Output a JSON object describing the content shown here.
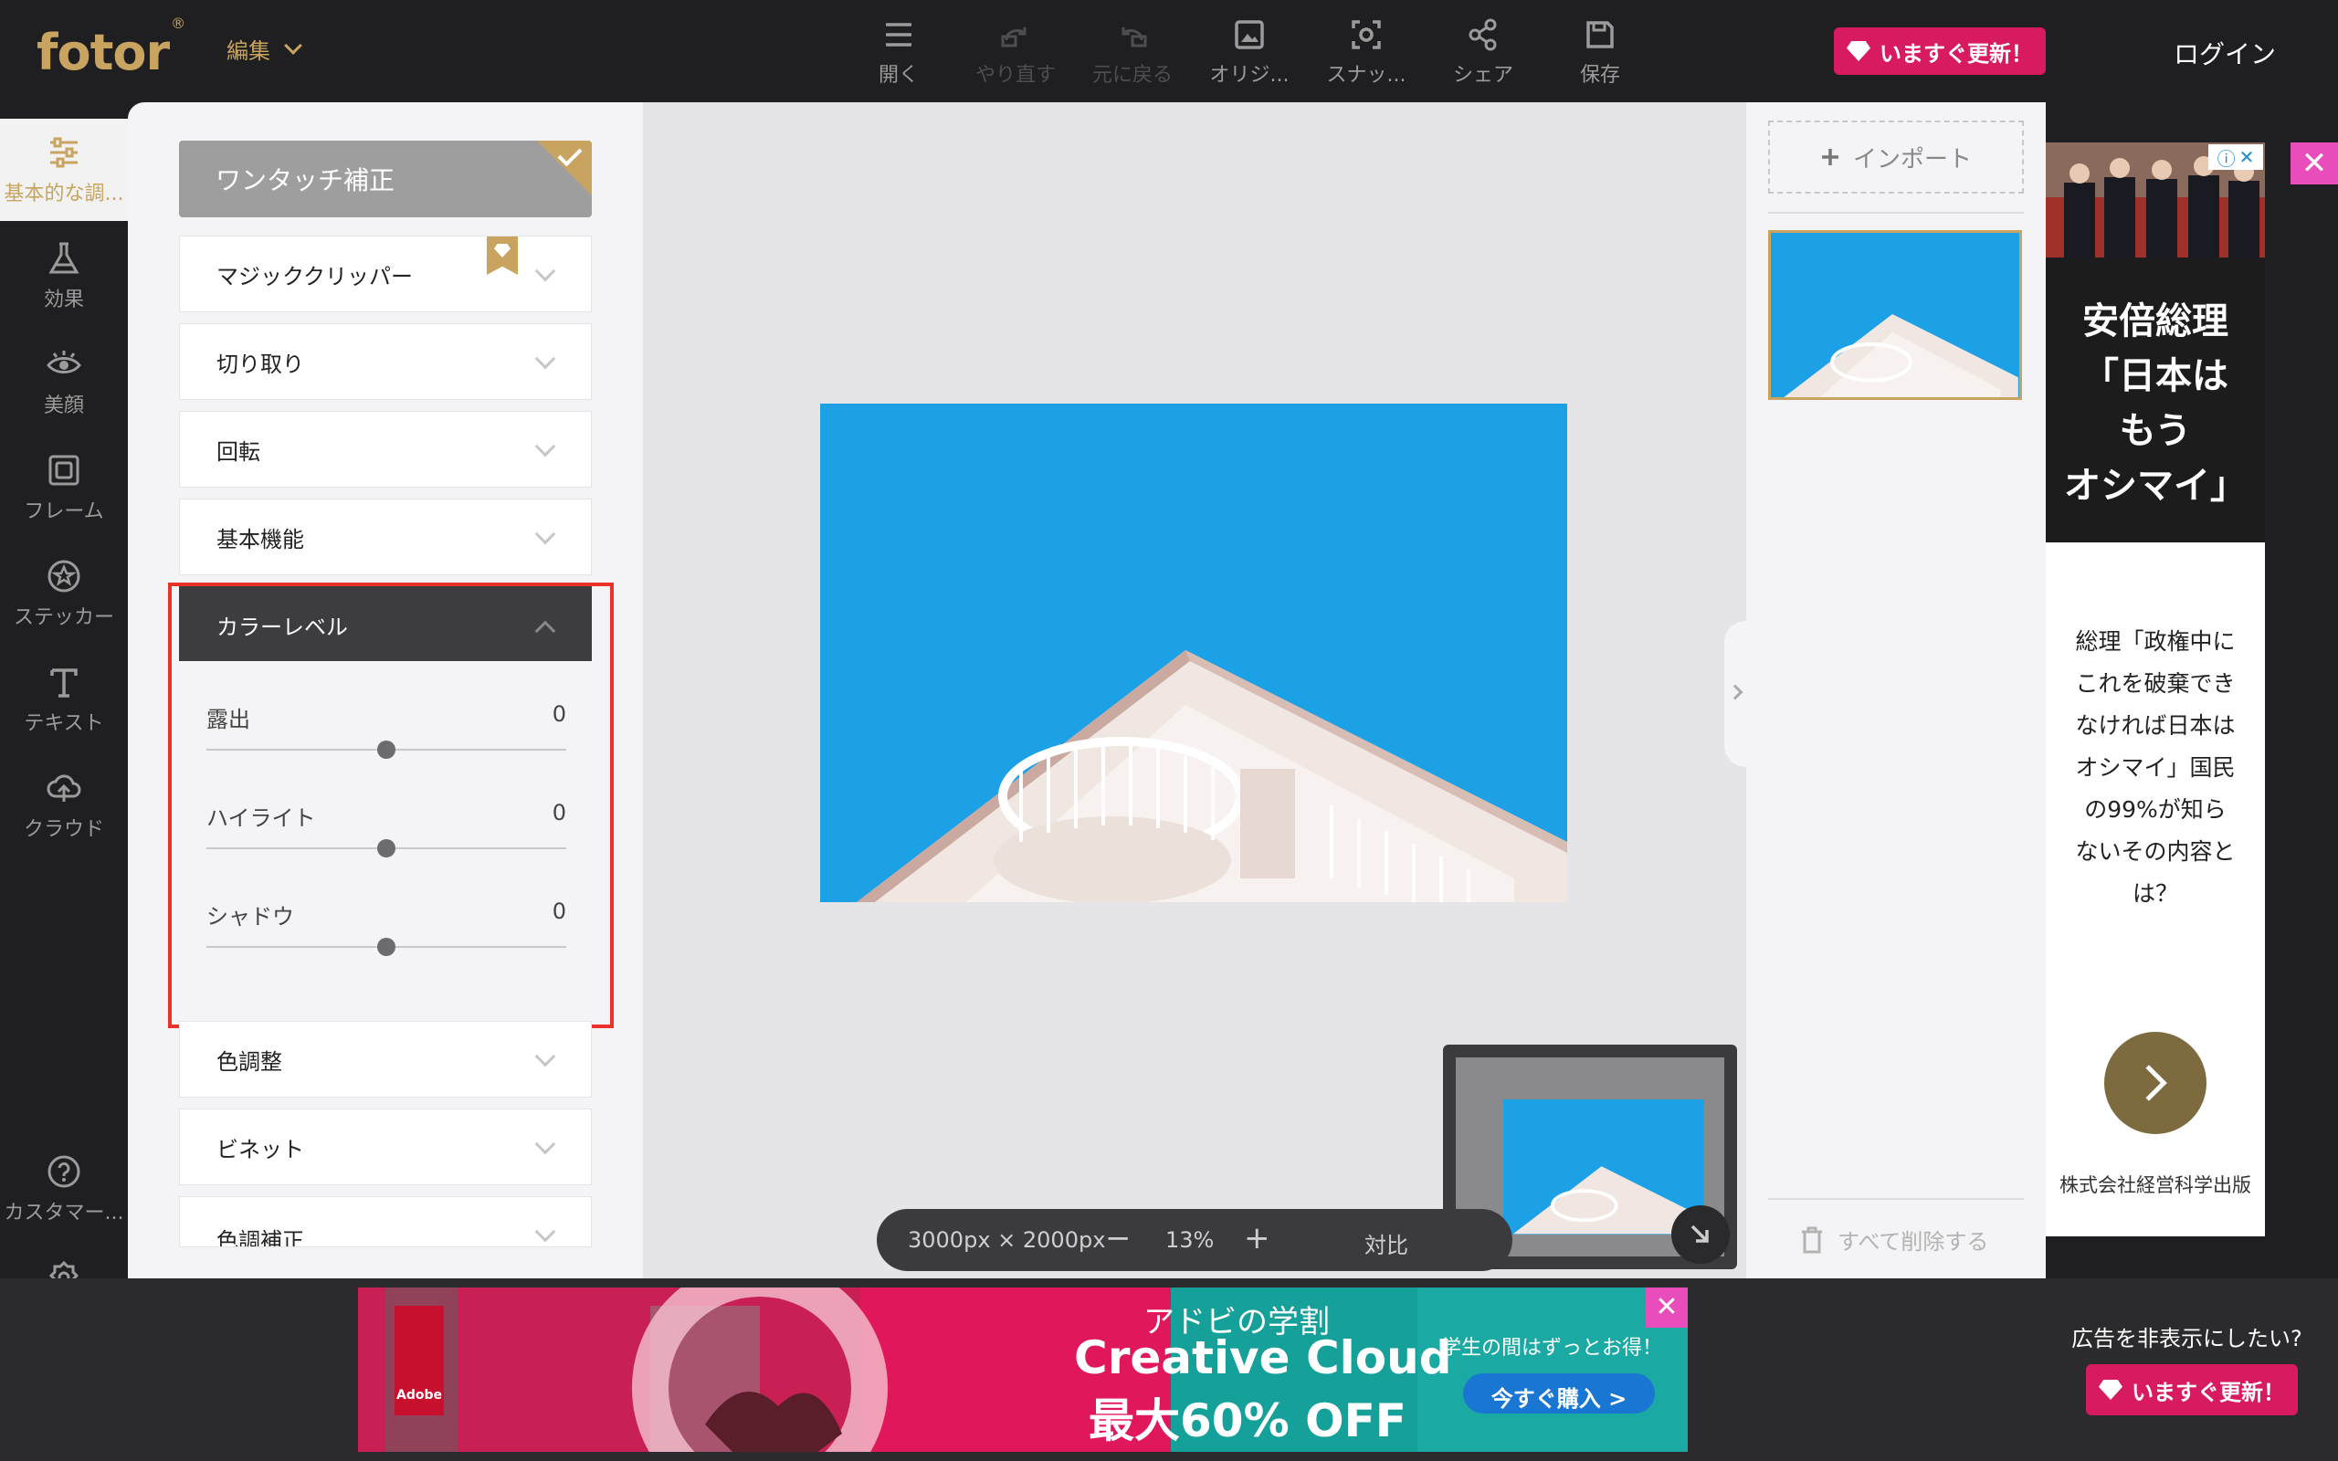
{
  "app": {
    "logo": "fotor",
    "logo_mark": "®",
    "edit_menu": "編集",
    "login": "ログイン",
    "upgrade": "いますぐ更新！"
  },
  "toolbar": [
    {
      "label": "開く",
      "icon": "menu-icon",
      "enabled": true
    },
    {
      "label": "やり直す",
      "icon": "redo-icon",
      "enabled": false
    },
    {
      "label": "元に戻る",
      "icon": "undo-icon",
      "enabled": false
    },
    {
      "label": "オリジ...",
      "icon": "image-icon",
      "enabled": true
    },
    {
      "label": "スナッ...",
      "icon": "snapshot-icon",
      "enabled": true
    },
    {
      "label": "シェア",
      "icon": "share-icon",
      "enabled": true
    },
    {
      "label": "保存",
      "icon": "save-icon",
      "enabled": true
    }
  ],
  "rail": [
    {
      "label": "基本的な調...",
      "icon": "sliders-icon",
      "active": true
    },
    {
      "label": "効果",
      "icon": "flask-icon"
    },
    {
      "label": "美顔",
      "icon": "eye-icon"
    },
    {
      "label": "フレーム",
      "icon": "frame-icon"
    },
    {
      "label": "ステッカー",
      "icon": "star-icon"
    },
    {
      "label": "テキスト",
      "icon": "text-icon"
    },
    {
      "label": "クラウド",
      "icon": "cloud-icon"
    },
    {
      "label": "カスタマー...",
      "icon": "help-icon"
    },
    {
      "label": "設定",
      "icon": "gear-icon"
    }
  ],
  "panel": {
    "one_touch": "ワンタッチ補正",
    "sections": {
      "magic": "マジッククリッパー",
      "crop": "切り取り",
      "rotate": "回転",
      "basic": "基本機能",
      "color_level": "カラーレベル",
      "color_adjust": "色調整",
      "vignette": "ビネット",
      "tone": "色調補正"
    },
    "sliders": [
      {
        "label": "露出",
        "value": "0",
        "position": 0.5
      },
      {
        "label": "ハイライト",
        "value": "0",
        "position": 0.5
      },
      {
        "label": "シャドウ",
        "value": "0",
        "position": 0.5
      }
    ]
  },
  "canvas": {
    "dimensions": "3000px × 2000px",
    "zoom": "13%",
    "compare": "対比",
    "zoom_out": "−",
    "zoom_in": "+"
  },
  "right_panel": {
    "import": "インポート",
    "delete_all": "すべて削除する"
  },
  "ad_right": {
    "headline": [
      "安倍総理",
      "「日本は",
      "もう",
      "オシマイ」"
    ],
    "body": [
      "総理「政権中に",
      "これを破棄でき",
      "なければ日本は",
      "オシマイ」国民",
      "の99%が知ら",
      "ないその内容と",
      "は？"
    ],
    "company": "株式会社経営科学出版",
    "close": "✕"
  },
  "ad_bottom": {
    "line1": "アドビの学割",
    "line2": "Creative Cloud",
    "line3": "最大60% OFF",
    "tag": "学生の間はずっとお得！",
    "cta": "今すぐ購入 >",
    "brand": "Adobe",
    "close": "✕"
  },
  "hide_ads": "広告を非表示にしたい?",
  "colors": {
    "accent": "#c8a460",
    "photo_sky": "#1ca0e6",
    "upgrade": "#d81b60",
    "highlight": "#e8322a"
  }
}
